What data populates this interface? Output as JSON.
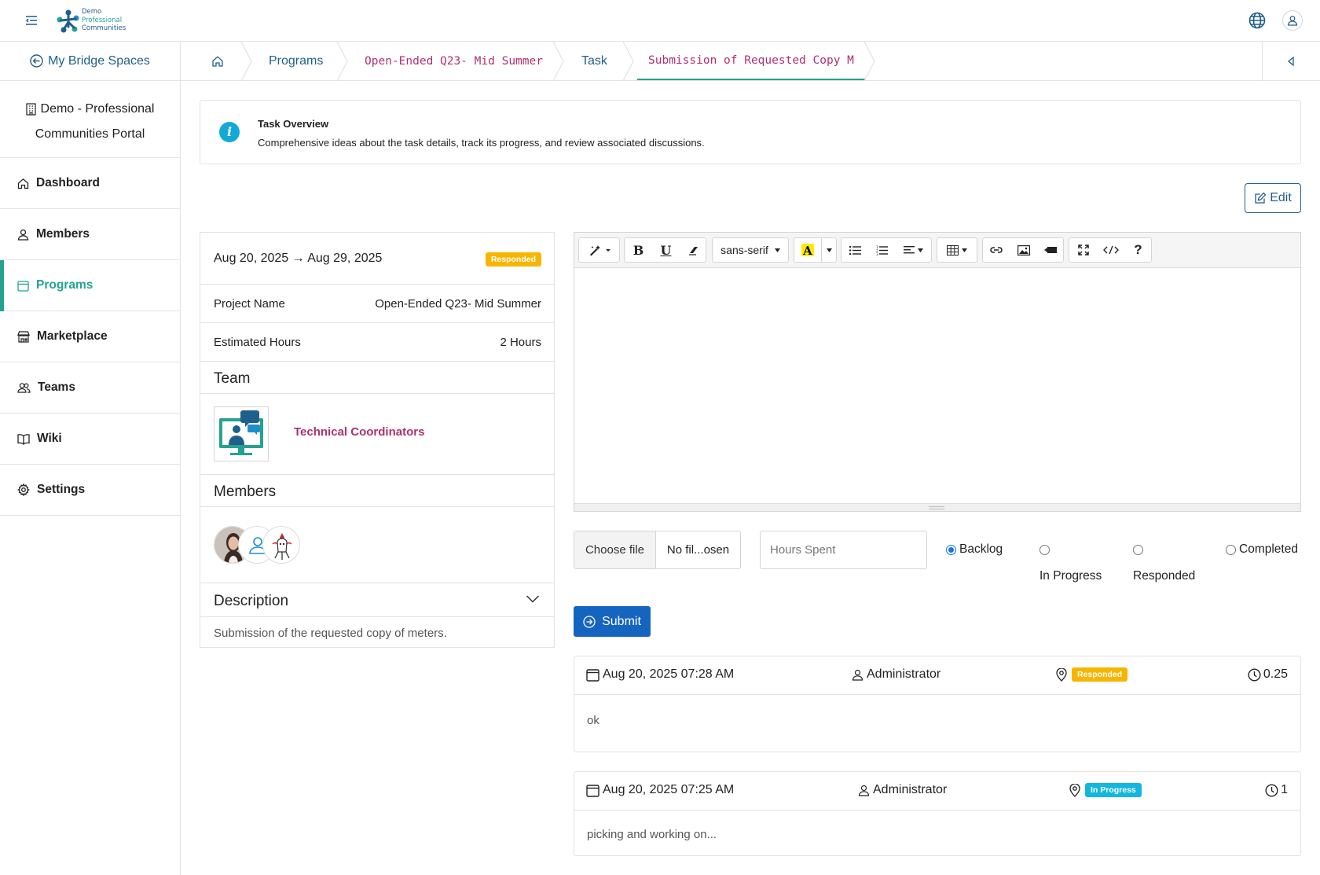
{
  "header": {
    "logo_lines": [
      "Demo",
      "Professional",
      "Communities"
    ],
    "logo_colors": {
      "primary": "#1f5f8b",
      "accent": "#23a38f"
    }
  },
  "sidebar": {
    "back_label": "My Bridge Spaces",
    "portal_line1": "Demo - Professional",
    "portal_line2": "Communities Portal",
    "items": [
      {
        "label": "Dashboard",
        "icon": "home-icon"
      },
      {
        "label": "Members",
        "icon": "user-icon"
      },
      {
        "label": "Programs",
        "icon": "calendar-icon",
        "active": true
      },
      {
        "label": "Marketplace",
        "icon": "store-icon"
      },
      {
        "label": "Teams",
        "icon": "users-icon"
      },
      {
        "label": "Wiki",
        "icon": "book-icon"
      },
      {
        "label": "Settings",
        "icon": "gear-icon"
      }
    ]
  },
  "breadcrumb": {
    "items": [
      "Programs",
      "Open-Ended Q23- Mid Summer",
      "Task",
      "Submission of Requested Copy M"
    ]
  },
  "overview": {
    "title": "Task Overview",
    "description": "Comprehensive ideas about the task details, track its progress, and review associated discussions."
  },
  "edit_label": "Edit",
  "task": {
    "date_start": "Aug 20, 2025",
    "date_arrow": "→",
    "date_end": "Aug 29, 2025",
    "status": "Responded",
    "project_label": "Project Name",
    "project_value": "Open-Ended Q23- Mid Summer",
    "hours_label": "Estimated Hours",
    "hours_value": "2 Hours",
    "team_heading": "Team",
    "team_name": "Technical Coordinators",
    "members_heading": "Members",
    "description_heading": "Description",
    "description": "Submission of the requested copy of meters."
  },
  "editor": {
    "font_select": "sans-serif"
  },
  "form": {
    "choose_file": "Choose file",
    "no_file": "No fil...osen",
    "hours_placeholder": "Hours Spent",
    "statuses": [
      "Backlog",
      "In Progress",
      "Responded",
      "Completed"
    ],
    "selected_status": "Backlog",
    "submit_label": "Submit"
  },
  "entries": [
    {
      "datetime": "Aug 20, 2025 07:28 AM",
      "author": "Administrator",
      "status": "Responded",
      "status_color": "#f7b500",
      "hours": "0.25",
      "text": "ok"
    },
    {
      "datetime": "Aug 20, 2025 07:25 AM",
      "author": "Administrator",
      "status": "In Progress",
      "status_color": "#12b7e0",
      "hours": "1",
      "text": "picking and working on..."
    }
  ]
}
